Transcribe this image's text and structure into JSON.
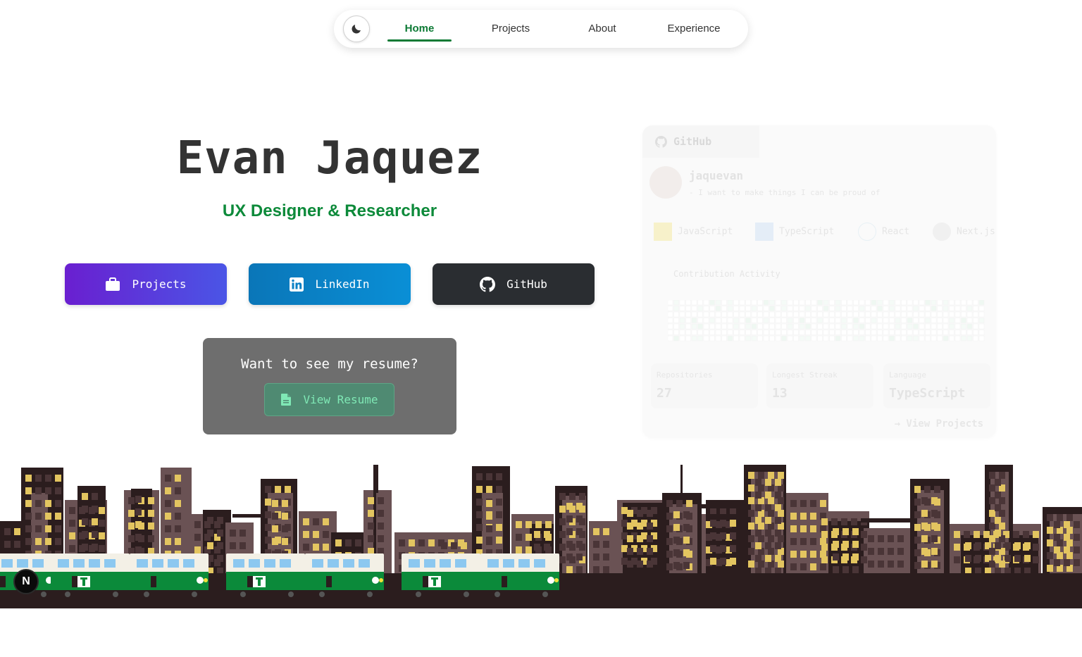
{
  "nav": {
    "theme_icon": "moon-icon",
    "items": [
      {
        "label": "Home",
        "active": true
      },
      {
        "label": "Projects",
        "active": false
      },
      {
        "label": "About",
        "active": false
      },
      {
        "label": "Experience",
        "active": false
      }
    ],
    "active_color": "#0d7a35"
  },
  "hero": {
    "name": "Evan Jaquez",
    "role": "UX Designer & Researcher",
    "buttons": [
      {
        "label": "Projects",
        "icon": "briefcase-icon"
      },
      {
        "label": "LinkedIn",
        "icon": "linkedin-icon"
      },
      {
        "label": "GitHub",
        "icon": "github-icon"
      }
    ],
    "resume": {
      "question": "Want to see my resume?",
      "button_label": "View Resume",
      "icon": "document-icon"
    }
  },
  "github_card": {
    "tab_label": "GitHub",
    "username": "jaquevan",
    "bio": "- I want to make things I can be proud of",
    "tech": [
      {
        "label": "JavaScript",
        "icon": "javascript-icon"
      },
      {
        "label": "TypeScript",
        "icon": "typescript-icon"
      },
      {
        "label": "React",
        "icon": "react-icon"
      },
      {
        "label": "Next.js",
        "icon": "nextjs-icon"
      }
    ],
    "contribution_title": "Contribution Activity",
    "stats": [
      {
        "label": "Repositories",
        "value": "27"
      },
      {
        "label": "Longest Streak",
        "value": "13"
      },
      {
        "label": "Language",
        "value": "TypeScript"
      }
    ],
    "link": "→ View Projects"
  },
  "footer": {
    "badge": "N"
  },
  "colors": {
    "brand_green": "#0d8a3a",
    "projects_gradient": [
      "#6a1fd0",
      "#4a55e6"
    ],
    "linkedin_gradient": [
      "#0a76b8",
      "#0a8fd6"
    ],
    "github_btn": "#2a2d31",
    "city_ground": "#2b1d1e",
    "train_green": "#0b8a3a"
  }
}
